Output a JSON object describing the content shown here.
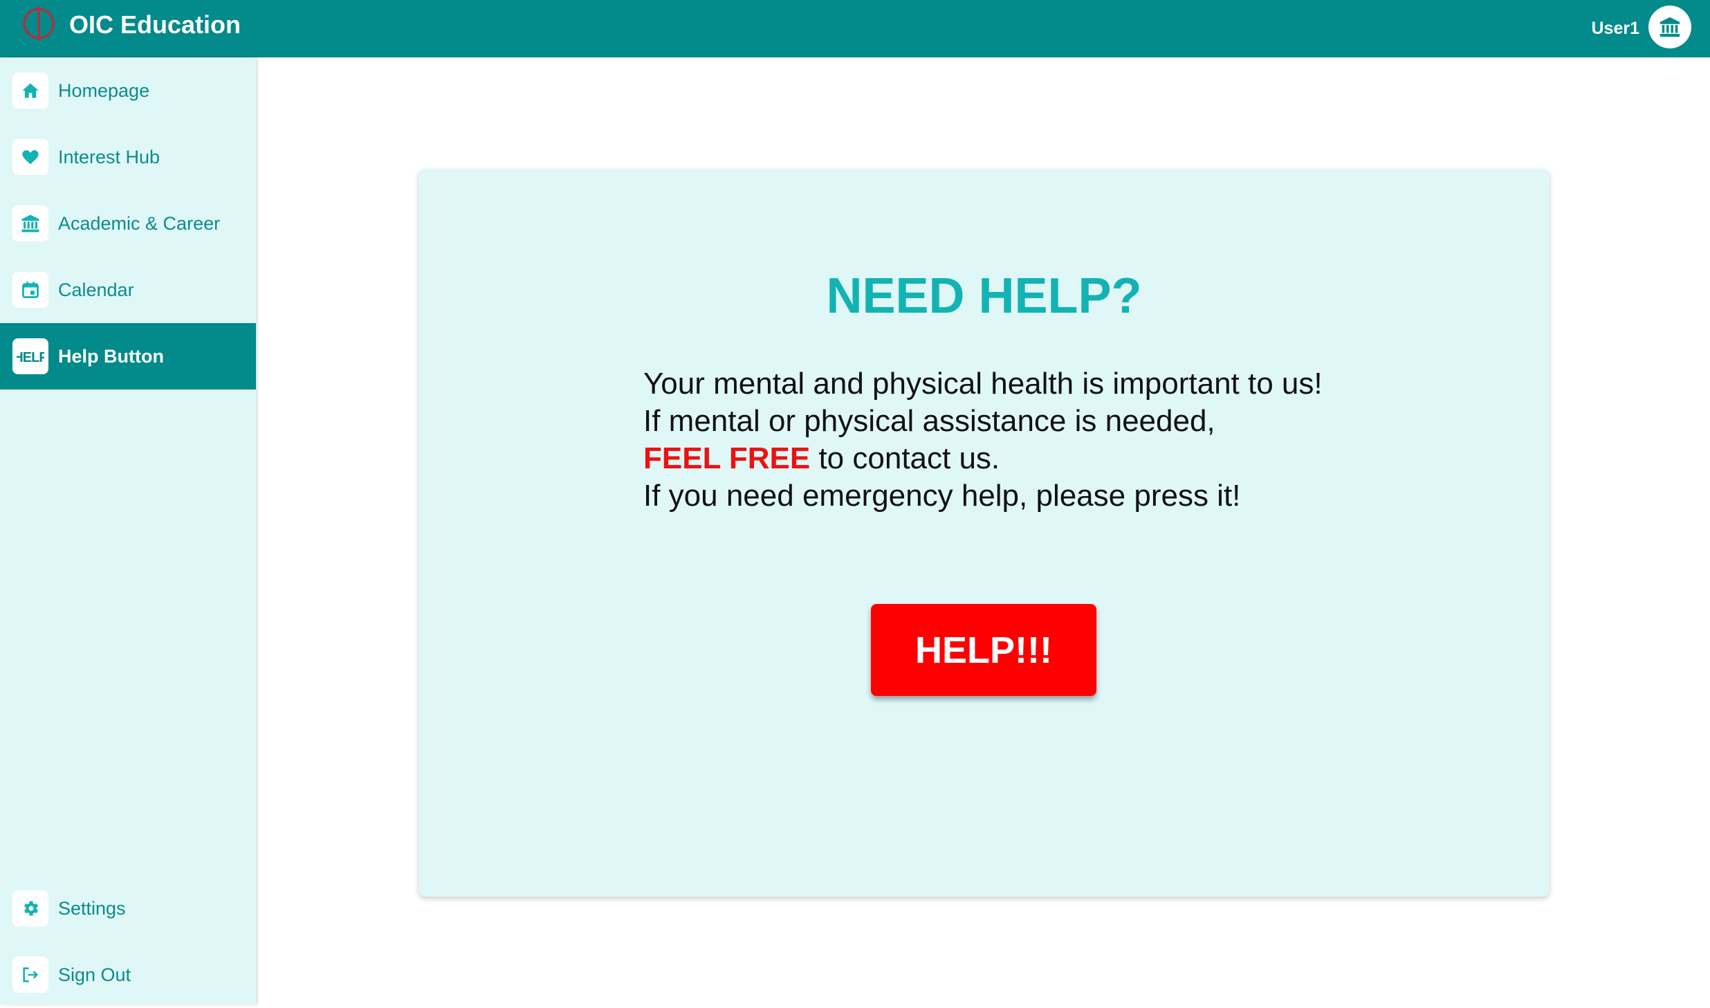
{
  "app": {
    "title": "OIC Education"
  },
  "user": {
    "name": "User1",
    "avatar_icon": "bank-icon"
  },
  "sidebar": {
    "items": [
      {
        "label": "Homepage",
        "icon": "home-icon"
      },
      {
        "label": "Interest Hub",
        "icon": "heart-icon"
      },
      {
        "label": "Academic & Career",
        "icon": "bank-icon"
      },
      {
        "label": "Calendar",
        "icon": "calendar-icon"
      },
      {
        "label": "Help Button",
        "icon": "help-badge-icon",
        "active": true
      }
    ],
    "bottom_items": [
      {
        "label": "Settings",
        "icon": "gear-icon"
      },
      {
        "label": "Sign Out",
        "icon": "sign-out-icon"
      }
    ]
  },
  "main": {
    "title": "NEED HELP?",
    "line1": "Your mental and physical health is important to us!",
    "line2": "If mental or physical assistance is needed,",
    "line3_emphasis": "FEEL FREE",
    "line3_rest": " to contact us.",
    "line4": "If you need emergency help, please press it!",
    "help_button_label": "HELP!!!"
  },
  "colors": {
    "brand": "#038a8a",
    "sidebar_bg": "#e0f7f7",
    "title": "#13b3b3",
    "alert": "#ff0000"
  }
}
